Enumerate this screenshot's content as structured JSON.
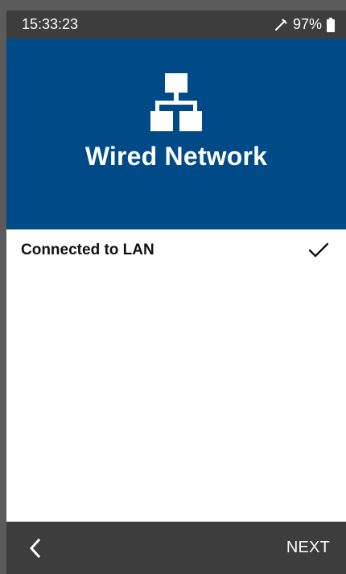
{
  "status_bar": {
    "time": "15:33:23",
    "battery_percent": "97%",
    "icons": [
      "probe-icon",
      "battery-icon"
    ]
  },
  "header": {
    "title": "Wired Network",
    "icon": "network-topology-icon"
  },
  "connection": {
    "label": "Connected to LAN",
    "status_icon": "check-icon"
  },
  "bottom_bar": {
    "next_label": "NEXT",
    "back_icon": "chevron-left-icon"
  },
  "colors": {
    "header_blue": "#004b87",
    "status_bar": "#3d3d3d",
    "bottom_bar": "#3d3d3d",
    "content_background": "#ffffff",
    "text_light": "#ffffff",
    "text_dark": "#111111"
  }
}
